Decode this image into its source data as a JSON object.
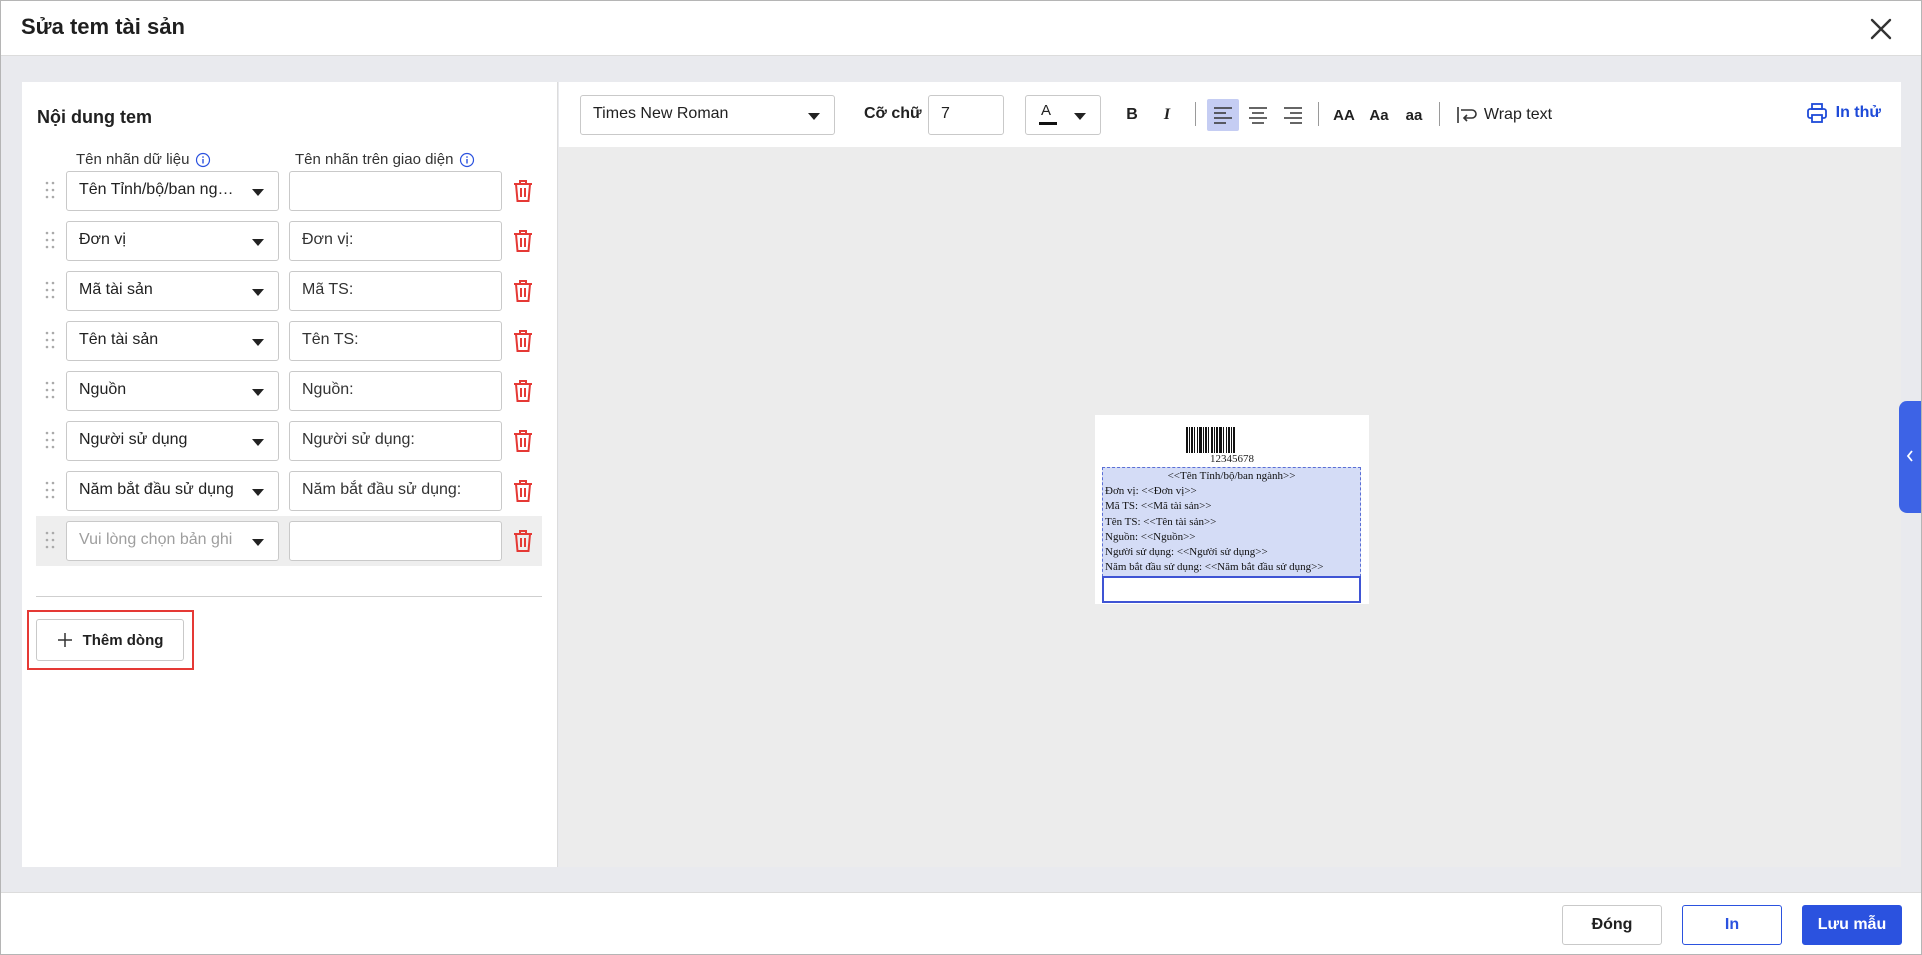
{
  "dialog": {
    "title": "Sửa tem tài sản"
  },
  "left_panel": {
    "title": "Nội dung tem",
    "col_data_label": "Tên nhãn dữ liệu",
    "col_ui_label": "Tên nhãn trên giao diện",
    "rows": [
      {
        "field": "Tên Tỉnh/bộ/ban ngành",
        "label": ""
      },
      {
        "field": "Đơn vị",
        "label": "Đơn vị:"
      },
      {
        "field": "Mã tài sản",
        "label": "Mã TS:"
      },
      {
        "field": "Tên tài sản",
        "label": "Tên TS:"
      },
      {
        "field": "Nguồn",
        "label": "Nguồn:"
      },
      {
        "field": "Người sử dụng",
        "label": "Người sử dụng:"
      },
      {
        "field": "Năm bắt đầu sử dụng",
        "label": "Năm bắt đầu sử dụng:"
      },
      {
        "field": "",
        "label": "",
        "placeholder": "Vui lòng chọn bản ghi"
      }
    ],
    "add_row_label": "Thêm dòng"
  },
  "toolbar": {
    "font_family": "Times New Roman",
    "font_size_label": "Cỡ chữ",
    "font_size_value": "7",
    "color_letter": "A",
    "bold": "B",
    "italic": "I",
    "upper": "AA",
    "title_case": "Aa",
    "lower": "aa",
    "wrap_text": "Wrap text",
    "print_test": "In thử",
    "active_align": "left"
  },
  "preview": {
    "barcode_number": "12345678",
    "lines": [
      "<<Tên Tỉnh/bộ/ban ngành>>",
      "Đơn vị: <<Đơn vị>>",
      "Mã TS: <<Mã tài sản>>",
      "Tên TS: <<Tên tài sản>>",
      "Nguồn: <<Nguồn>>",
      "Người sử dụng: <<Người sử dụng>>",
      "Năm bắt đầu sử dụng: <<Năm bắt đầu sử dụng>>"
    ]
  },
  "footer": {
    "close_label": "Đóng",
    "print_label": "In",
    "save_label": "Lưu mẫu"
  },
  "colors": {
    "primary": "#2b52df",
    "danger": "#e53935",
    "preview_fill": "#d4dcf6"
  }
}
